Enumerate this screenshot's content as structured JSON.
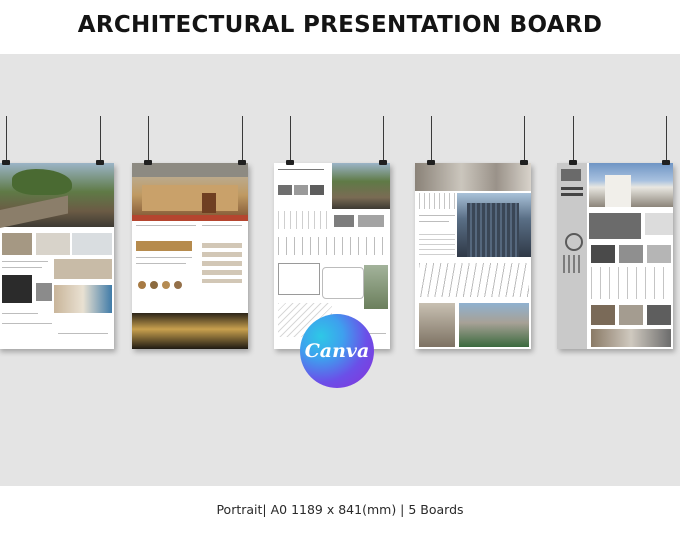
{
  "header": {
    "title": "ARCHITECTURAL PRESENTATION BOARD"
  },
  "logo": {
    "text": "Canva",
    "name": "canva-logo"
  },
  "footer": {
    "caption": "Portrait| A0 1189 x 841(mm)  | 5 Boards"
  },
  "colors": {
    "background": "#ffffff",
    "wall": "#e4e4e4",
    "logo_gradient_start": "#2ec8e6",
    "logo_gradient_end": "#8a2fd8"
  }
}
